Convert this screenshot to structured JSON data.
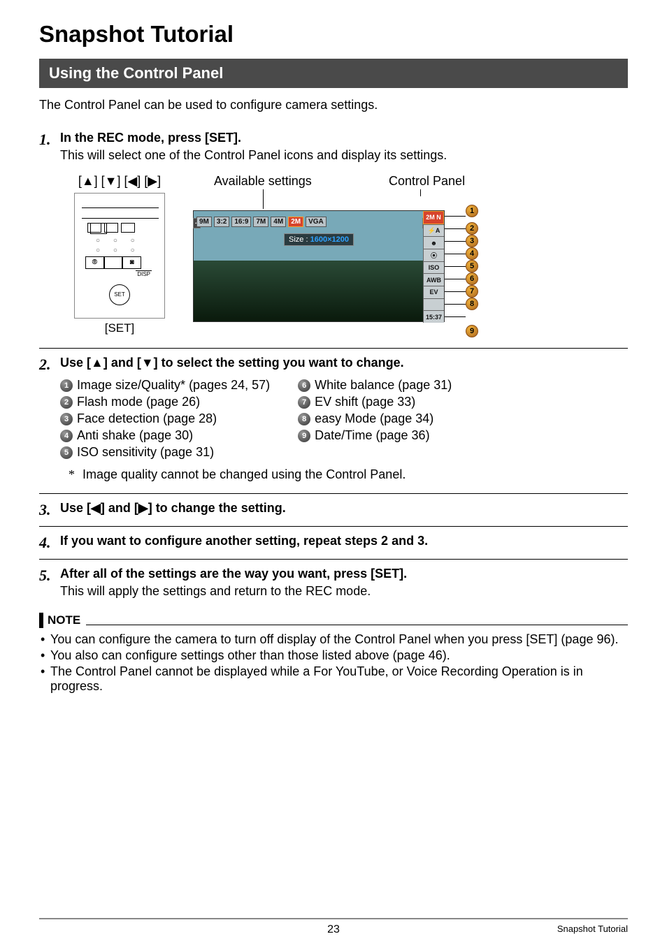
{
  "doc_title": "Snapshot Tutorial",
  "section_title": "Using the Control Panel",
  "intro": "The Control Panel can be used to configure camera settings.",
  "step1": {
    "num": "1.",
    "title": "In the REC mode, press [SET].",
    "desc": "This will select one of the Control Panel icons and display its settings."
  },
  "diagram": {
    "left_label": "[▲] [▼] [◀] [▶]",
    "set_caption": "[SET]",
    "avail_label": "Available settings",
    "cp_label": "Control Panel",
    "lcd_options": [
      "9M",
      "3:2",
      "16:9",
      "7M",
      "4M",
      "2M",
      "VGA"
    ],
    "lcd_options_sel_index": 5,
    "lcd_size_prefix": "Size :",
    "lcd_size_value": "1600×1200",
    "cp_cells": [
      "2M N",
      "⚡A",
      "☻",
      "⦿",
      "ISO",
      "AWB",
      "EV",
      " ",
      "15:37"
    ],
    "cp_sel_index": 0,
    "disp_label": "DISP"
  },
  "step2": {
    "num": "2.",
    "title": "Use [▲] and [▼] to select the setting you want to change."
  },
  "settings": [
    {
      "n": "1",
      "text": "Image size/Quality* (pages 24, 57)"
    },
    {
      "n": "2",
      "text": "Flash mode (page 26)"
    },
    {
      "n": "3",
      "text": "Face detection (page 28)"
    },
    {
      "n": "4",
      "text": "Anti shake (page 30)"
    },
    {
      "n": "5",
      "text": "ISO sensitivity (page 31)"
    },
    {
      "n": "6",
      "text": "White balance (page 31)"
    },
    {
      "n": "7",
      "text": "EV shift (page 33)"
    },
    {
      "n": "8",
      "text": "easy Mode (page 34)"
    },
    {
      "n": "9",
      "text": "Date/Time (page 36)"
    }
  ],
  "footnote_marker": "*",
  "footnote_text": "Image quality cannot be changed using the Control Panel.",
  "step3": {
    "num": "3.",
    "title": "Use [◀] and [▶] to change the setting."
  },
  "step4": {
    "num": "4.",
    "title": "If you want to configure another setting, repeat steps 2 and 3."
  },
  "step5": {
    "num": "5.",
    "title": "After all of the settings are the way you want, press [SET].",
    "desc": "This will apply the settings and return to the REC mode."
  },
  "note": {
    "label": "NOTE",
    "items": [
      "You can configure the camera to turn off display of the Control Panel when you press [SET] (page 96).",
      "You also can configure settings other than those listed above (page 46).",
      "The Control Panel cannot be displayed while a For YouTube, or Voice Recording Operation is in progress."
    ]
  },
  "footer": {
    "page_number": "23",
    "right_text": "Snapshot Tutorial"
  }
}
